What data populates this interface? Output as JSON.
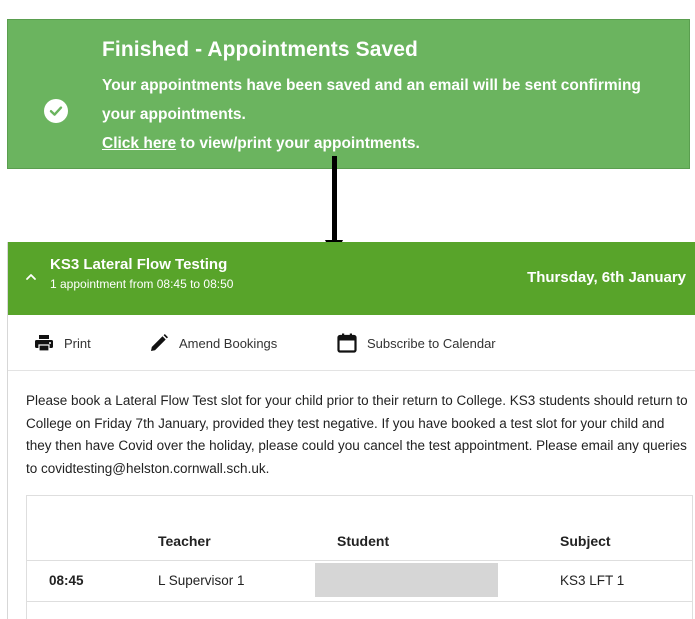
{
  "banner": {
    "title": "Finished - Appointments Saved",
    "message": "Your appointments have been saved and an email will be sent confirming your appointments.",
    "link_text": "Click here",
    "link_suffix": " to view/print your appointments.",
    "icon": "check-circle-icon",
    "background": "#6bb45f"
  },
  "event": {
    "title": "KS3 Lateral Flow Testing",
    "subtitle": "1 appointment from 08:45 to 08:50",
    "date": "Thursday, 6th January",
    "header_color": "#58a42a"
  },
  "toolbar": {
    "print_label": "Print",
    "amend_label": "Amend Bookings",
    "subscribe_label": "Subscribe to Calendar"
  },
  "description": "Please book a Lateral Flow Test slot for your child prior to their return to College. KS3 students should return to College on Friday 7th January, provided they test negative. If you have booked a test slot for your child and they then have Covid over the holiday, please could you cancel the test appointment. Please email any queries to covidtesting@helston.cornwall.sch.uk.",
  "table": {
    "headers": [
      "",
      "Teacher",
      "Student",
      "Subject"
    ],
    "rows": [
      {
        "time": "08:45",
        "teacher": "L Supervisor 1",
        "student": "",
        "subject": "KS3 LFT 1"
      }
    ]
  }
}
